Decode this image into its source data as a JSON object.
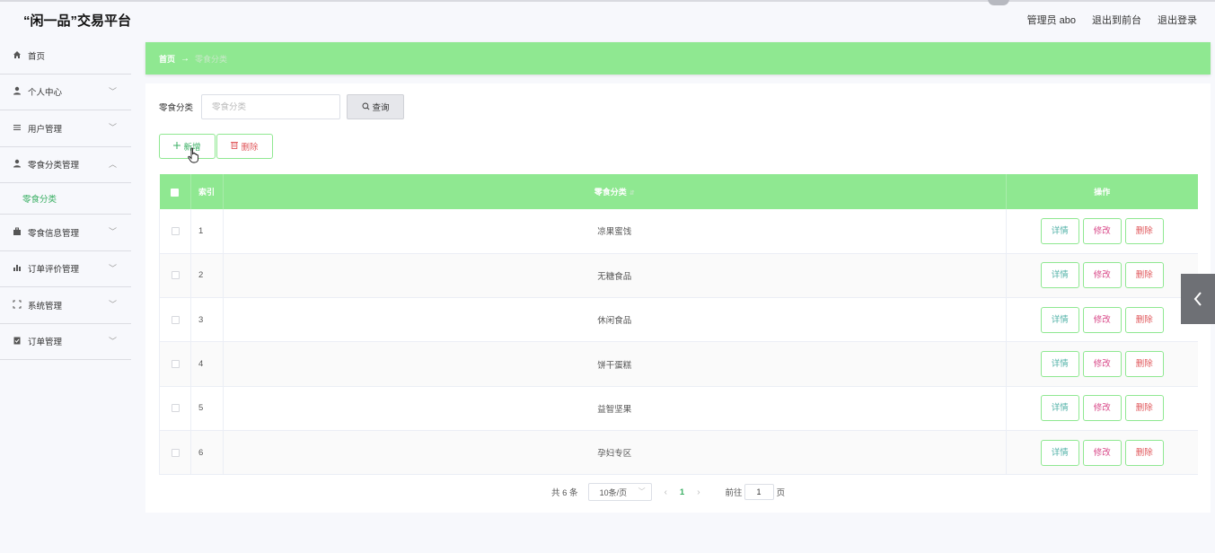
{
  "header": {
    "brand": "“闲一品”交易平台",
    "admin_label": "管理员 abo",
    "back_front": "退出到前台",
    "logout": "退出登录"
  },
  "sidebar": {
    "items": [
      {
        "label": "首页",
        "icon": "home-icon",
        "chevron": ""
      },
      {
        "label": "个人中心",
        "icon": "user-icon",
        "chevron": "﹀"
      },
      {
        "label": "用户管理",
        "icon": "list-icon",
        "chevron": "﹀"
      },
      {
        "label": "零食分类管理",
        "icon": "user-icon",
        "chevron": "︿"
      },
      {
        "label": "零食信息管理",
        "icon": "briefcase-icon",
        "chevron": "﹀"
      },
      {
        "label": "订单评价管理",
        "icon": "bar-chart-icon",
        "chevron": "﹀"
      },
      {
        "label": "系统管理",
        "icon": "frame-icon",
        "chevron": "﹀"
      },
      {
        "label": "订单管理",
        "icon": "clipboard-icon",
        "chevron": "﹀"
      }
    ],
    "sub_item": "零食分类"
  },
  "breadcrumb": {
    "home": "首页",
    "separator": "→",
    "current": "零食分类"
  },
  "search": {
    "label": "零食分类",
    "placeholder": "零食分类",
    "value": "",
    "button": "查询"
  },
  "actions": {
    "add": "新增",
    "delete": "删除"
  },
  "table": {
    "columns": {
      "index": "索引",
      "category": "零食分类",
      "ops": "操作"
    },
    "rows": [
      {
        "index": "1",
        "category": "凉果蜜饯"
      },
      {
        "index": "2",
        "category": "无糖食品"
      },
      {
        "index": "3",
        "category": "休闲食品"
      },
      {
        "index": "4",
        "category": "饼干蛋糕"
      },
      {
        "index": "5",
        "category": "益智坚果"
      },
      {
        "index": "6",
        "category": "孕妇专区"
      }
    ],
    "row_buttons": {
      "detail": "详情",
      "edit": "修改",
      "delete": "删除"
    }
  },
  "pagination": {
    "total": "共 6 条",
    "page_size": "10条/页",
    "prev": "‹",
    "current_page": "1",
    "next": "›",
    "goto_label": "前往",
    "goto_value": "1",
    "page_unit": "页"
  },
  "colors": {
    "accent": "#8fe891",
    "accent_text": "#3aaf63",
    "danger": "#e0575b"
  }
}
